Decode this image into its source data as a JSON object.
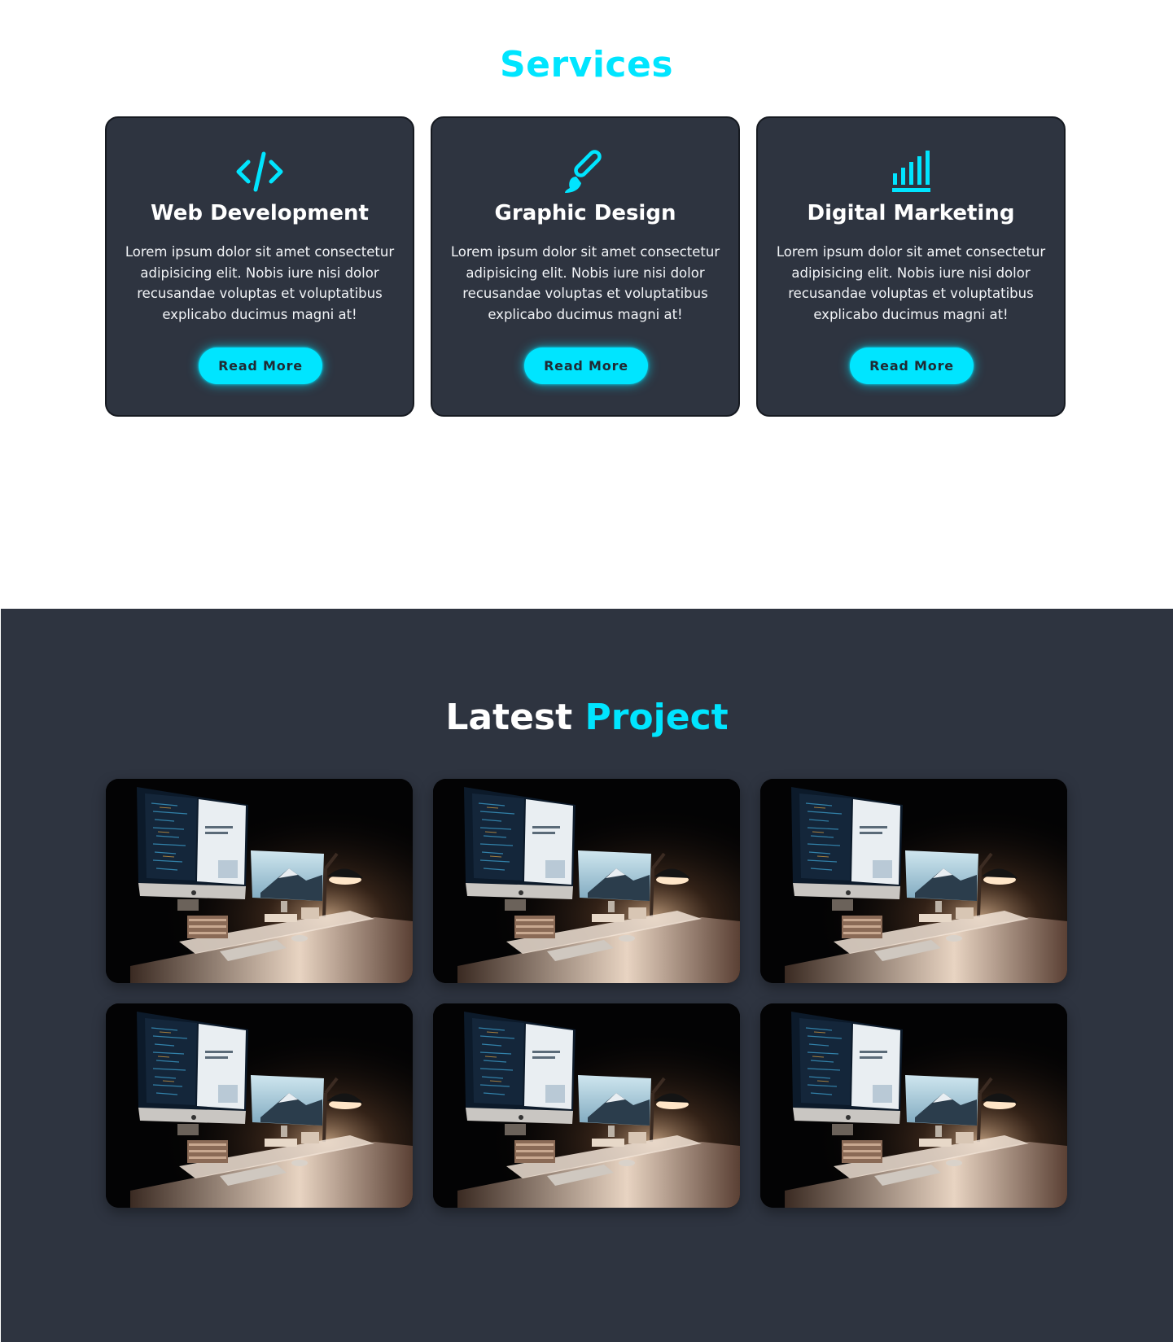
{
  "services": {
    "title": "Services",
    "cards": [
      {
        "icon": "code-icon",
        "title": "Web Development",
        "text": "Lorem ipsum dolor sit amet consectetur adipisicing elit. Nobis iure nisi dolor recusandae voluptas et voluptatibus explicabo ducimus magni at!",
        "button": "Read More"
      },
      {
        "icon": "paintbrush-icon",
        "title": "Graphic Design",
        "text": "Lorem ipsum dolor sit amet consectetur adipisicing elit. Nobis iure nisi dolor recusandae voluptas et voluptatibus explicabo ducimus magni at!",
        "button": "Read More"
      },
      {
        "icon": "bar-chart-icon",
        "title": "Digital Marketing",
        "text": "Lorem ipsum dolor sit amet consectetur adipisicing elit. Nobis iure nisi dolor recusandae voluptas et voluptatibus explicabo ducimus magni at!",
        "button": "Read More"
      }
    ]
  },
  "projects": {
    "title_main": "Latest",
    "title_accent": "Project",
    "items": [
      {
        "image": "desk-workspace-photo"
      },
      {
        "image": "desk-workspace-photo"
      },
      {
        "image": "desk-workspace-photo"
      },
      {
        "image": "desk-workspace-photo"
      },
      {
        "image": "desk-workspace-photo"
      },
      {
        "image": "desk-workspace-photo"
      }
    ]
  },
  "colors": {
    "accent": "#00e5ff",
    "dark_background": "#2e3440",
    "card_background": "#2e3440",
    "button_text": "#1f2a33",
    "light_background": "#ffffff"
  }
}
